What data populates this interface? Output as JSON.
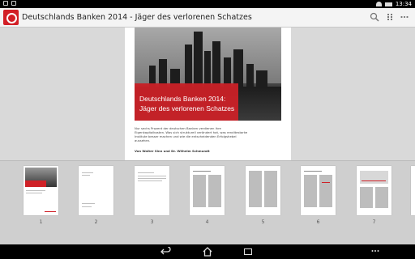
{
  "status_bar": {
    "time": "13:34"
  },
  "action_bar": {
    "title": "Deutschlands Banken 2014 - Jäger des verlorenen Schatzes",
    "icons": [
      "search-icon",
      "grid-icon",
      "overflow-menu-icon"
    ]
  },
  "page": {
    "cover_title_line1": "Deutschlands Banken 2014:",
    "cover_title_line2": "Jäger des verlorenen Schatzes",
    "body": "Nur sechs Prozent der deutschen Banken verdienen ihre Eigenkapitalkosten. Was sich strukturell verändert hat, was renditestarke Institute besser machen und wie die entscheidenden Erfolgshebel aussehen.",
    "authors": "Von Walter Sinn und Dr. Wilhelm Schmundt"
  },
  "thumbnails": [
    {
      "label": "1"
    },
    {
      "label": "2"
    },
    {
      "label": "3"
    },
    {
      "label": "4"
    },
    {
      "label": "5"
    },
    {
      "label": "6"
    },
    {
      "label": "7"
    }
  ],
  "nav_bar": {
    "icons": [
      "back-icon",
      "home-icon",
      "recents-icon",
      "overflow-icon"
    ]
  },
  "colors": {
    "brand_red": "#d21f26",
    "page_bg": "#d9d9d9"
  }
}
